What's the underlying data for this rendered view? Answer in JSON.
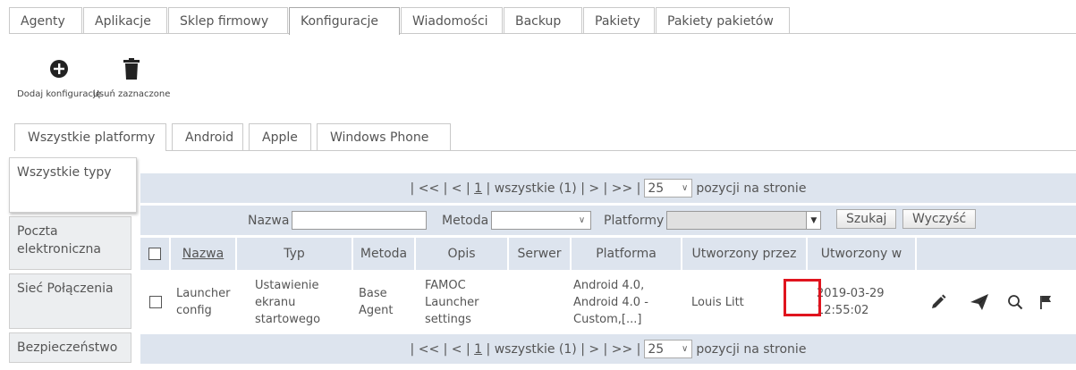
{
  "top_tabs": [
    "Agenty",
    "Aplikacje",
    "Sklep firmowy",
    "Konfiguracje",
    "Wiadomości",
    "Backup",
    "Pakiety",
    "Pakiety pakietów"
  ],
  "toolbar": {
    "add_label": "Dodaj konfigurację",
    "delete_label": "Usuń zaznaczone"
  },
  "platform_tabs": [
    "Wszystkie platformy",
    "Android",
    "Apple",
    "Windows Phone"
  ],
  "side_categories": [
    "Wszystkie typy",
    "Poczta elektroniczna",
    "Sieć Połączenia",
    "Bezpieczeństwo"
  ],
  "pager": {
    "prefix": "| << | < |",
    "page": "1",
    "middle": "| wszystkie (1) | > | >> |",
    "page_size": "25",
    "suffix": "pozycji na stronie"
  },
  "filter": {
    "name_label": "Nazwa",
    "method_label": "Metoda",
    "platforms_label": "Platformy",
    "search_button": "Szukaj",
    "clear_button": "Wyczyść"
  },
  "columns": [
    "Nazwa",
    "Typ",
    "Metoda",
    "Opis",
    "Serwer",
    "Platforma",
    "Utworzony przez",
    "Utworzony w"
  ],
  "rows": [
    {
      "name": "Launcher config",
      "type": "Ustawienie ekranu startowego",
      "method": "Base Agent",
      "description": "FAMOC Launcher settings",
      "server": "",
      "platform": "Android 4.0, Android 4.0 - Custom,[...]",
      "created_by": "Louis Litt",
      "created_at": "2019-03-29 12:55:02"
    }
  ],
  "highlight_color": "#e0141e"
}
